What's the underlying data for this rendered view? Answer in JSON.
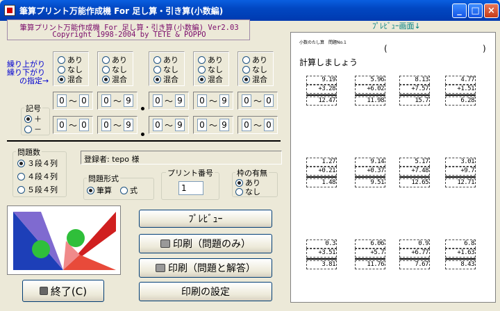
{
  "window": {
    "title": "筆算プリント万能作成機 For 足し算・引き算(小数編)",
    "minimize": "_",
    "maximize": "□",
    "close": "×"
  },
  "header": {
    "line1": "筆算プリント万能作成機 For 足し算・引き算(小数編) Ver2.03",
    "line2": "Copyright 1998-2004 by TETE & POPPO"
  },
  "carry": {
    "label1": "繰り上がり",
    "label2": "繰り下がり",
    "label3": "の指定→",
    "options": [
      "あり",
      "なし",
      "混合"
    ],
    "selected": [
      2,
      2,
      2,
      2,
      2
    ]
  },
  "sign": {
    "title": "記号",
    "plus": "＋",
    "minus": "－"
  },
  "ranges": {
    "tilde": "～",
    "top": [
      [
        "0",
        "0"
      ],
      [
        "0",
        "9"
      ],
      [
        "0",
        "9"
      ],
      [
        "0",
        "9"
      ],
      [
        "0",
        "0"
      ]
    ],
    "bottom": [
      [
        "0",
        "0"
      ],
      [
        "0",
        "9"
      ],
      [
        "0",
        "9"
      ],
      [
        "0",
        "9"
      ],
      [
        "0",
        "0"
      ]
    ]
  },
  "problem_count": {
    "title": "問題数",
    "options": [
      "３段４列",
      "４段４列",
      "５段４列"
    ],
    "selected": 0
  },
  "registrant": "登録者: tepo 様",
  "problem_format": {
    "title": "問題形式",
    "options": [
      "筆算",
      "式"
    ],
    "selected": 0
  },
  "print_number": {
    "title": "プリント番号",
    "value": "1"
  },
  "frame": {
    "title": "枠の有無",
    "options": [
      "あり",
      "なし"
    ],
    "selected": 0
  },
  "buttons": {
    "preview": "ﾌﾟﾚﾋﾞｭｰ",
    "print_problems": "印刷（問題のみ）",
    "print_with_answers": "印刷（問題と解答）",
    "print_settings": "印刷の設定",
    "exit": "終了(C)"
  },
  "preview": {
    "label": "ﾌﾟﾚﾋﾞｭｰ画面↓",
    "sheet_title": "小数のたし算　問題No.1",
    "name_paren_open": "(",
    "name_paren_close": ")",
    "instruction": "計算しましょう",
    "problems": [
      [
        "9.19",
        "+3.28",
        "12.47"
      ],
      [
        "5.96",
        "+6.02",
        "11.98"
      ],
      [
        "8.13",
        "+7.57",
        "15.7"
      ],
      [
        "4.77",
        "+1.51",
        "6.28"
      ],
      [
        "1.27",
        "+0.21",
        "1.48"
      ],
      [
        "9.14",
        "+0.37",
        "9.51"
      ],
      [
        "5.17",
        "+7.48",
        "12.65"
      ],
      [
        "3.01",
        "+9.7",
        "12.71"
      ],
      [
        "0.3",
        "+3.51",
        "3.81"
      ],
      [
        "6.06",
        "+5.7",
        "11.76"
      ],
      [
        "0.9",
        "+6.77",
        "7.67"
      ],
      [
        "6.8",
        "+1.63",
        "8.43"
      ]
    ]
  },
  "colors": {
    "titlebar": "#0147c2",
    "face": "#ece9d8",
    "header_text": "#7a0a6a",
    "carry_label": "#0000d0",
    "preview_label": "#008080"
  }
}
